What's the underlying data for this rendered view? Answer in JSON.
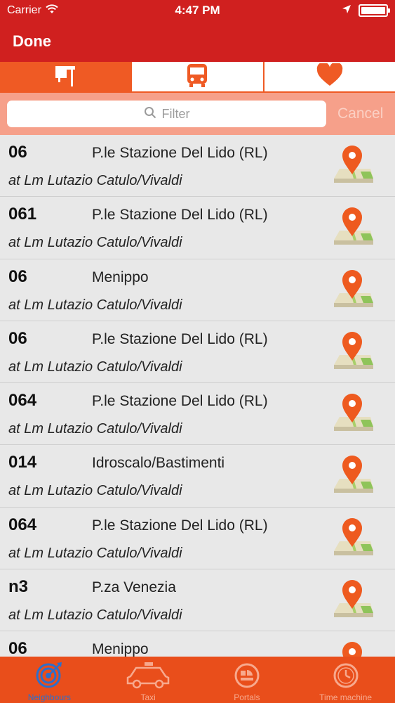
{
  "status": {
    "carrier": "Carrier",
    "time": "4:47 PM"
  },
  "nav": {
    "done_label": "Done"
  },
  "segments": [
    {
      "icon": "bus-stop-sign-icon",
      "active": true
    },
    {
      "icon": "bus-icon",
      "active": false
    },
    {
      "icon": "heart-icon",
      "active": false
    }
  ],
  "search": {
    "placeholder": "Filter",
    "cancel_label": "Cancel"
  },
  "rows": [
    {
      "line": "06",
      "dest": "P.le Stazione Del Lido (RL)",
      "stop": "at Lm Lutazio Catulo/Vivaldi"
    },
    {
      "line": "061",
      "dest": "P.le Stazione Del Lido (RL)",
      "stop": "at Lm Lutazio Catulo/Vivaldi"
    },
    {
      "line": "06",
      "dest": "Menippo",
      "stop": "at Lm Lutazio Catulo/Vivaldi"
    },
    {
      "line": "06",
      "dest": "P.le Stazione Del Lido (RL)",
      "stop": "at Lm Lutazio Catulo/Vivaldi"
    },
    {
      "line": "064",
      "dest": "P.le Stazione Del Lido (RL)",
      "stop": "at Lm Lutazio Catulo/Vivaldi"
    },
    {
      "line": "014",
      "dest": "Idroscalo/Bastimenti",
      "stop": "at Lm Lutazio Catulo/Vivaldi"
    },
    {
      "line": "064",
      "dest": "P.le Stazione Del Lido (RL)",
      "stop": "at Lm Lutazio Catulo/Vivaldi"
    },
    {
      "line": "n3",
      "dest": "P.za Venezia",
      "stop": "at Lm Lutazio Catulo/Vivaldi"
    },
    {
      "line": "06",
      "dest": "Menippo",
      "stop": ""
    }
  ],
  "tabs": [
    {
      "label": "Neighbours",
      "icon": "target-icon",
      "active": true
    },
    {
      "label": "Taxi",
      "icon": "taxi-icon",
      "active": false
    },
    {
      "label": "Portals",
      "icon": "portals-icon",
      "active": false
    },
    {
      "label": "Time machine",
      "icon": "clock-icon",
      "active": false
    }
  ],
  "colors": {
    "header": "#d0201f",
    "accent": "#ef5a24",
    "tabbar": "#e94e1b",
    "active_tab": "#2d6fcc"
  }
}
